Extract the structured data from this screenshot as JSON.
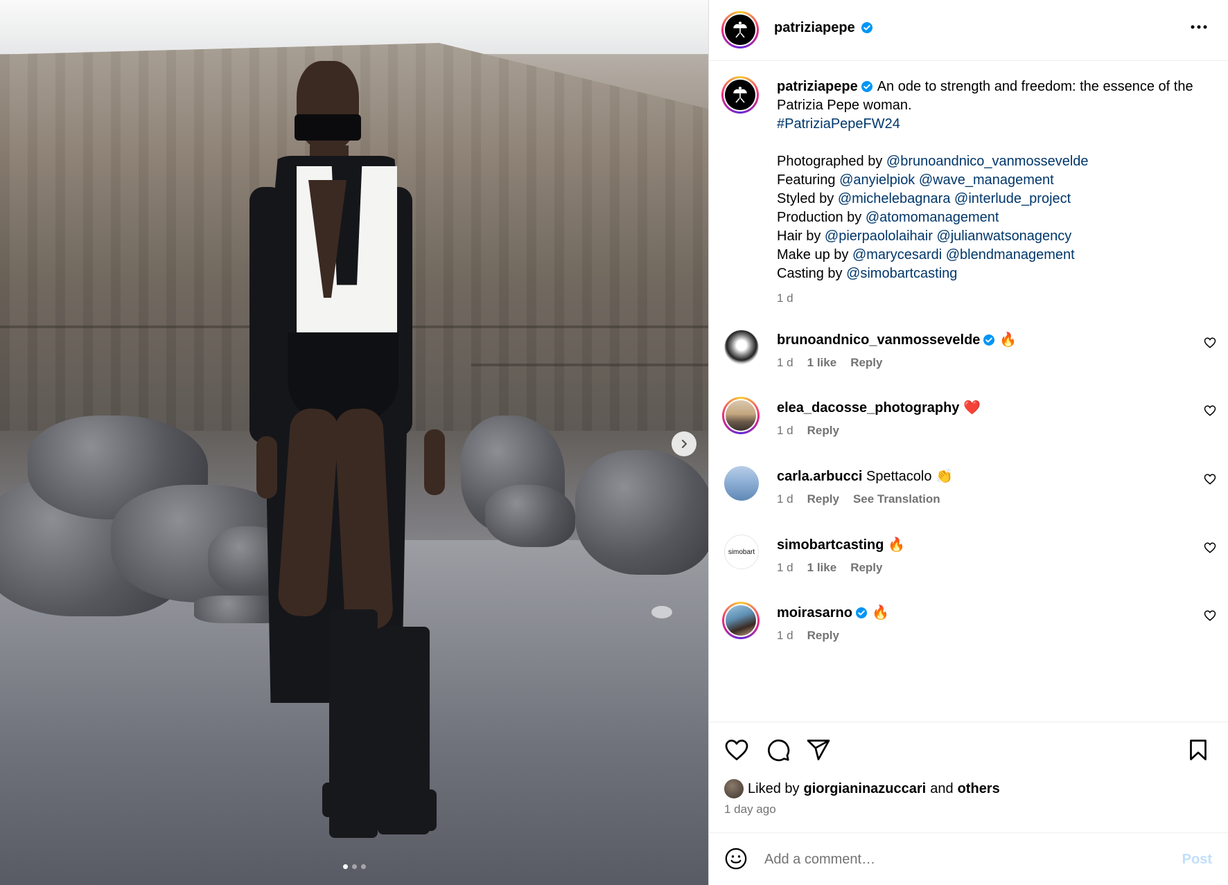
{
  "post": {
    "username": "patriziapepe",
    "verified": true,
    "image_alt": "",
    "carousel": {
      "count": 3,
      "active": 0
    }
  },
  "caption": {
    "username": "patriziapepe",
    "text": "An ode to strength and freedom: the essence of the Patrizia Pepe woman.",
    "hashtag": "#PatriziaPepeFW24",
    "credits": [
      {
        "label": "Photographed by",
        "handles": [
          "@brunoandnico_vanmossevelde"
        ]
      },
      {
        "label": "Featuring",
        "handles": [
          "@anyielpiok",
          "@wave_management"
        ]
      },
      {
        "label": "Styled by",
        "handles": [
          "@michelebagnara",
          "@interlude_project"
        ]
      },
      {
        "label": "Production by",
        "handles": [
          "@atomomanagement"
        ]
      },
      {
        "label": "Hair by",
        "handles": [
          "@pierpaololaihair",
          "@julianwatsonagency"
        ]
      },
      {
        "label": "Make up by",
        "handles": [
          "@marycesardi",
          "@blendmanagement"
        ]
      },
      {
        "label": "Casting by",
        "handles": [
          "@simobartcasting"
        ]
      }
    ],
    "time": "1 d"
  },
  "comments": [
    {
      "username": "brunoandnico_vanmossevelde",
      "verified": true,
      "text": "🔥",
      "time": "1 d",
      "likes": "1 like",
      "reply": "Reply",
      "translation": ""
    },
    {
      "username": "elea_dacosse_photography",
      "verified": false,
      "text": "❤️",
      "time": "1 d",
      "likes": "",
      "reply": "Reply",
      "translation": ""
    },
    {
      "username": "carla.arbucci",
      "verified": false,
      "text": "Spettacolo 👏",
      "time": "1 d",
      "likes": "",
      "reply": "Reply",
      "translation": "See Translation"
    },
    {
      "username": "simobartcasting",
      "verified": false,
      "text": "🔥",
      "time": "1 d",
      "likes": "1 like",
      "reply": "Reply",
      "translation": "",
      "avatar_text": "simobart"
    },
    {
      "username": "moirasarno",
      "verified": true,
      "text": "🔥",
      "time": "1 d",
      "likes": "",
      "reply": "Reply",
      "translation": ""
    }
  ],
  "likes": {
    "prefix": "Liked by",
    "user": "giorgianinazuccari",
    "and": "and",
    "others": "others"
  },
  "posted_ago": "1 day ago",
  "comment_box": {
    "placeholder": "Add a comment…",
    "post_label": "Post"
  },
  "icons": [
    "more-icon",
    "verified-icon",
    "heart-icon",
    "comment-icon",
    "share-icon",
    "bookmark-icon",
    "emoji-icon",
    "chevron-right-icon"
  ],
  "colors": {
    "link": "#00376b",
    "muted": "#737373",
    "verified": "#0095f6",
    "post_disabled": "#c0dffd"
  }
}
